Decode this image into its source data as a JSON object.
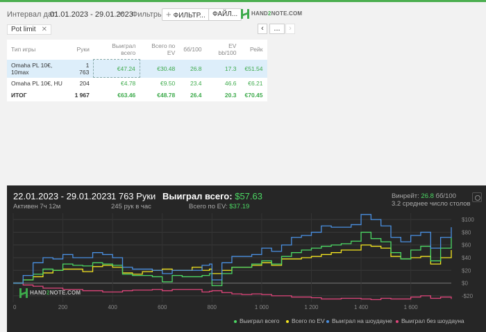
{
  "toolbar": {
    "date_label": "Интервал дат:",
    "date_value": "01.01.2023 - 29.01.2023",
    "filters_label": "Фильтры:",
    "filter_button": "ФИЛЬТР...",
    "file_button": "ФАЙЛ...",
    "logo_text_a": "HAND",
    "logo_text_b": "2",
    "logo_text_c": "NOTE.COM"
  },
  "chip": {
    "label": "Pot limit",
    "close": "✕"
  },
  "nav": {
    "prev": "‹",
    "mid": "...",
    "next": "›"
  },
  "table": {
    "headers": [
      "Тип игры",
      "Руки",
      "Выиграл всего",
      "Всего по EV",
      "бб/100",
      "EV bb/100",
      "Рейк"
    ],
    "rows": [
      [
        "Omaha PL 10€, 10max",
        "1 763",
        "€47.24",
        "€30.48",
        "26.8",
        "17.3",
        "€51.54"
      ],
      [
        "Omaha PL 10€, HU",
        "204",
        "€4.78",
        "€9.50",
        "23.4",
        "46.6",
        "€6.21"
      ],
      [
        "ИТОГ",
        "1 967",
        "€63.46",
        "€48.78",
        "26.4",
        "20.3",
        "€70.45"
      ]
    ]
  },
  "panel": {
    "date_range": "22.01.2023 - 29.01.2023",
    "active": "Активен 7ч 12м",
    "hands": "1 763 Руки",
    "hands_per_hour": "245 рук в час",
    "won_label": "Выиграл всего:",
    "won_value": "$57.63",
    "ev_label": "Всего по EV:",
    "ev_value": "$37.19",
    "winrate_label": "Винрейт:",
    "winrate_value": "26.8",
    "winrate_unit": "бб/100",
    "avg_tables": "3.2 среднее число столов",
    "watermark_a": "HAND",
    "watermark_b": "2",
    "watermark_c": "NOTE.COM"
  },
  "colors": {
    "green": "#4cd964",
    "yellow": "#f5e620",
    "blue": "#4a90e2",
    "pink": "#e0457b",
    "accent": "#4caf50"
  },
  "chart_data": {
    "type": "line",
    "xlabel": "",
    "ylabel": "",
    "xlim": [
      0,
      1763
    ],
    "ylim": [
      -30,
      110
    ],
    "x_ticks": [
      "0",
      "200",
      "400",
      "600",
      "800",
      "1 000",
      "1 200",
      "1 400",
      "1 600"
    ],
    "x_tick_values": [
      0,
      200,
      400,
      600,
      800,
      1000,
      1200,
      1400,
      1600
    ],
    "y_ticks": [
      "$100",
      "$80",
      "$60",
      "$40",
      "$20",
      "$0",
      "-$20"
    ],
    "y_tick_values": [
      100,
      80,
      60,
      40,
      20,
      0,
      -20
    ],
    "grid": true,
    "legend_position": "bottom-right",
    "series": [
      {
        "name": "Выиграл всего",
        "color": "#4cd964",
        "x": [
          0,
          40,
          80,
          120,
          160,
          200,
          240,
          280,
          320,
          360,
          400,
          440,
          480,
          520,
          560,
          600,
          640,
          680,
          720,
          760,
          790,
          800,
          840,
          880,
          920,
          960,
          1000,
          1040,
          1080,
          1120,
          1160,
          1200,
          1240,
          1280,
          1320,
          1360,
          1400,
          1440,
          1480,
          1520,
          1560,
          1600,
          1640,
          1680,
          1720,
          1763
        ],
        "y": [
          0,
          5,
          14,
          22,
          20,
          30,
          28,
          27,
          32,
          30,
          28,
          14,
          12,
          12,
          10,
          2,
          12,
          10,
          10,
          12,
          15,
          -4,
          15,
          25,
          25,
          30,
          35,
          30,
          42,
          48,
          52,
          55,
          58,
          60,
          62,
          66,
          80,
          70,
          65,
          48,
          38,
          52,
          58,
          35,
          55,
          72
        ]
      },
      {
        "name": "Всего по EV",
        "color": "#f5e620",
        "x": [
          0,
          40,
          80,
          120,
          160,
          200,
          240,
          280,
          320,
          360,
          400,
          440,
          480,
          520,
          560,
          600,
          640,
          680,
          720,
          760,
          790,
          800,
          840,
          880,
          920,
          960,
          1000,
          1040,
          1080,
          1120,
          1160,
          1200,
          1240,
          1280,
          1320,
          1360,
          1400,
          1440,
          1480,
          1520,
          1560,
          1600,
          1640,
          1680,
          1720,
          1763
        ],
        "y": [
          0,
          5,
          10,
          16,
          20,
          22,
          22,
          18,
          26,
          28,
          25,
          16,
          14,
          18,
          20,
          22,
          20,
          20,
          25,
          20,
          22,
          15,
          20,
          25,
          25,
          28,
          32,
          28,
          38,
          38,
          40,
          42,
          45,
          48,
          52,
          52,
          60,
          58,
          55,
          42,
          38,
          40,
          42,
          30,
          40,
          52
        ]
      },
      {
        "name": "Выиграл на шоудауне",
        "color": "#4a90e2",
        "x": [
          0,
          40,
          80,
          120,
          160,
          200,
          240,
          280,
          320,
          360,
          400,
          440,
          480,
          520,
          560,
          600,
          640,
          680,
          720,
          760,
          790,
          800,
          840,
          880,
          920,
          960,
          1000,
          1040,
          1080,
          1120,
          1160,
          1200,
          1240,
          1280,
          1320,
          1360,
          1400,
          1440,
          1480,
          1520,
          1560,
          1600,
          1640,
          1680,
          1720,
          1763
        ],
        "y": [
          0,
          12,
          32,
          40,
          38,
          45,
          40,
          40,
          48,
          45,
          40,
          25,
          22,
          22,
          20,
          15,
          20,
          20,
          20,
          28,
          30,
          5,
          32,
          42,
          42,
          45,
          55,
          50,
          60,
          72,
          75,
          80,
          90,
          88,
          88,
          92,
          108,
          100,
          90,
          72,
          65,
          75,
          80,
          55,
          72,
          88
        ]
      },
      {
        "name": "Выиграл без шоудауна",
        "color": "#e0457b",
        "x": [
          0,
          40,
          80,
          120,
          160,
          200,
          240,
          280,
          320,
          360,
          400,
          440,
          480,
          520,
          560,
          600,
          640,
          680,
          720,
          760,
          790,
          800,
          840,
          880,
          920,
          960,
          1000,
          1040,
          1080,
          1120,
          1160,
          1200,
          1240,
          1280,
          1320,
          1360,
          1400,
          1440,
          1480,
          1520,
          1560,
          1600,
          1640,
          1680,
          1720,
          1763
        ],
        "y": [
          0,
          -3,
          -5,
          -8,
          -8,
          -10,
          -10,
          -12,
          -12,
          -14,
          -14,
          -12,
          -11,
          -11,
          -10,
          -12,
          -10,
          -10,
          -10,
          -14,
          -13,
          -12,
          -15,
          -17,
          -18,
          -17,
          -18,
          -20,
          -20,
          -22,
          -22,
          -23,
          -25,
          -25,
          -24,
          -24,
          -25,
          -26,
          -24,
          -25,
          -25,
          -22,
          -20,
          -24,
          -22,
          -25
        ]
      }
    ]
  }
}
